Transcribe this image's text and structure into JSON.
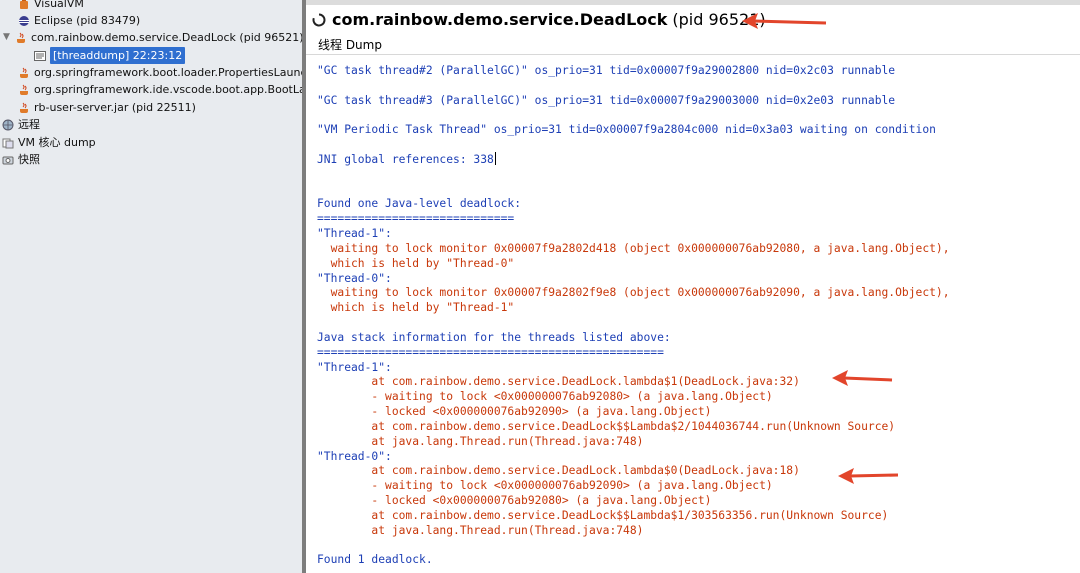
{
  "app": {
    "title": "com.rainbow.demo.service.DeadLock",
    "pid": "(pid 96521)",
    "tab": "线程 Dump"
  },
  "tree": {
    "visualvm": "VisualVM",
    "eclipse": "Eclipse (pid 83479)",
    "deadlock_app": "com.rainbow.demo.service.DeadLock (pid 96521)",
    "threaddump": "[threaddump] 22:23:12",
    "properties_launcher": "org.springframework.boot.loader.PropertiesLauncher",
    "vscode_boot": "org.springframework.ide.vscode.boot.app.BootLanguageServer",
    "rb_user": "rb-user-server.jar (pid 22511)",
    "remote": "远程",
    "vm_core": "VM 核心 dump",
    "snapshot": "快照"
  },
  "dump": {
    "l1": "\"GC task thread#2 (ParallelGC)\" os_prio=31 tid=0x00007f9a29002800 nid=0x2c03 runnable",
    "l2": "\"GC task thread#3 (ParallelGC)\" os_prio=31 tid=0x00007f9a29003000 nid=0x2e03 runnable",
    "l3": "\"VM Periodic Task Thread\" os_prio=31 tid=0x00007f9a2804c000 nid=0x3a03 waiting on condition",
    "l4": "JNI global references: 338",
    "l5": "Found one Java-level deadlock:",
    "l6": "=============================",
    "l7": "\"Thread-1\":",
    "l8": "  waiting to lock monitor 0x00007f9a2802d418 (object 0x000000076ab92080, a java.lang.Object),",
    "l9": "  which is held by \"Thread-0\"",
    "l10": "\"Thread-0\":",
    "l11": "  waiting to lock monitor 0x00007f9a2802f9e8 (object 0x000000076ab92090, a java.lang.Object),",
    "l12": "  which is held by \"Thread-1\"",
    "l13": "Java stack information for the threads listed above:",
    "l14": "===================================================",
    "l15": "\"Thread-1\":",
    "l16": "        at com.rainbow.demo.service.DeadLock.lambda$1(DeadLock.java:32)",
    "l17": "        - waiting to lock <0x000000076ab92080> (a java.lang.Object)",
    "l18": "        - locked <0x000000076ab92090> (a java.lang.Object)",
    "l19": "        at com.rainbow.demo.service.DeadLock$$Lambda$2/1044036744.run(Unknown Source)",
    "l20": "        at java.lang.Thread.run(Thread.java:748)",
    "l21": "\"Thread-0\":",
    "l22": "        at com.rainbow.demo.service.DeadLock.lambda$0(DeadLock.java:18)",
    "l23": "        - waiting to lock <0x000000076ab92090> (a java.lang.Object)",
    "l24": "        - locked <0x000000076ab92080> (a java.lang.Object)",
    "l25": "        at com.rainbow.demo.service.DeadLock$$Lambda$1/303563356.run(Unknown Source)",
    "l26": "        at java.lang.Thread.run(Thread.java:748)",
    "l27": "Found 1 deadlock."
  },
  "colors": {
    "text_blue": "#1d3fb5",
    "text_red": "#c8380a",
    "arrow": "#e2452b",
    "selection": "#2f6fd0"
  },
  "icons": [
    "java-cup-icon",
    "eclipse-icon",
    "threaddump-icon",
    "remote-host-icon",
    "core-dump-icon",
    "snapshot-icon",
    "loading-spinner-icon",
    "annotation-arrow-icon"
  ]
}
